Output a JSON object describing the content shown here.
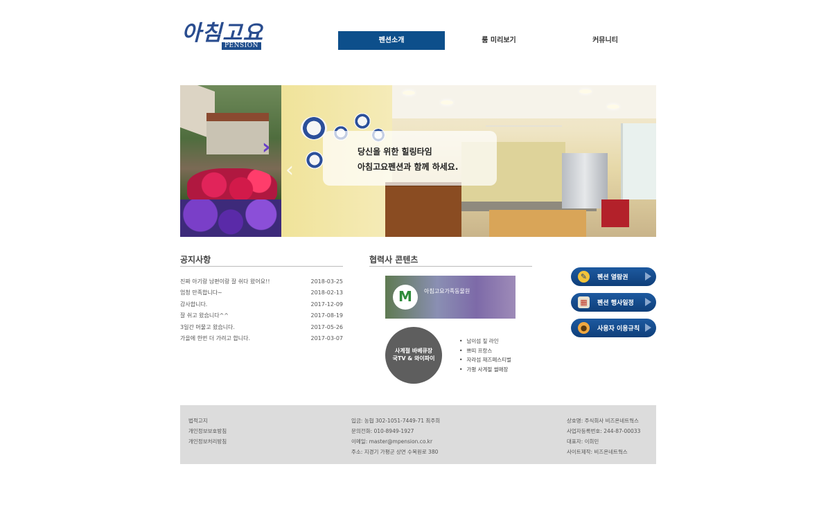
{
  "logo": {
    "text": "아침고요",
    "sub": "PENSION"
  },
  "nav": [
    {
      "label": "펜션소개",
      "active": true
    },
    {
      "label": "룸 미리보기",
      "active": false
    },
    {
      "label": "커뮤니티",
      "active": false
    }
  ],
  "hero": {
    "line1": "당신을 위한 힐링타임",
    "line2": "아침고요펜션과 함께 하세요."
  },
  "notice": {
    "title": "공지사항",
    "items": [
      {
        "text": "진짜 아기랑 남편이랑 잘 쉬다 왔어요!!",
        "date": "2018-03-25"
      },
      {
        "text": "엄청 만족합니다~",
        "date": "2018-02-13"
      },
      {
        "text": "감사합니다.",
        "date": "2017-12-09"
      },
      {
        "text": "잘 쉬고 왔습니다^^",
        "date": "2017-08-19"
      },
      {
        "text": "3일간 머물고 왔습니다.",
        "date": "2017-05-26"
      },
      {
        "text": "가을에 한번 더 가려고 합니다.",
        "date": "2017-03-07"
      }
    ]
  },
  "partner": {
    "title": "협력사 콘텐츠",
    "banner_title": "아침고요가족동물원",
    "circle_line1": "사계절 바베큐장",
    "circle_line2": "국TV & 와이파이",
    "bullets": [
      "남이섬 짚 라인",
      "쁘띠 프랑스",
      "자라섬 재즈페스티벌",
      "가평 사계절 썰매장"
    ]
  },
  "side_buttons": [
    {
      "label": "펜션 열람권",
      "icon": "pencil-icon"
    },
    {
      "label": "펜션 행사일정",
      "icon": "calendar-icon"
    },
    {
      "label": "사용자 이용규칙",
      "icon": "user-icon"
    }
  ],
  "footer": {
    "left": [
      "법적고지",
      "개인정보보호방침",
      "개인정보처리방침"
    ],
    "center": [
      "입금: 농협 302-1051-7449-71 최주희",
      "문의전화: 010-8949-1927",
      "이메일: master@mpension.co.kr",
      "주소: 지경기 가평군 상면 수목원로 380"
    ],
    "right": [
      "상호명: 주식회사 비즈온네트웍스",
      "사업자등록번호: 244-87-00033",
      "대표자: 이희민",
      "사이트제작: 비즈온네트웍스"
    ]
  },
  "colors": {
    "accent": "#0d4f8b",
    "footer_bg": "#dcdcdc",
    "circle": "#5e5e5e"
  }
}
